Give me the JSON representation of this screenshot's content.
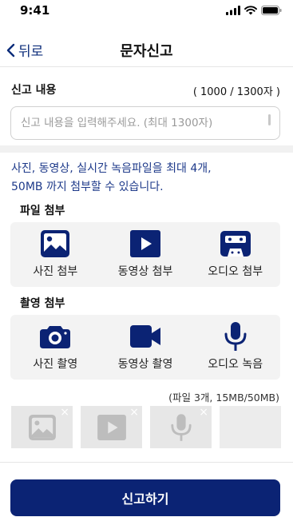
{
  "status": {
    "time": "9:41"
  },
  "nav": {
    "back_label": "뒤로",
    "title": "문자신고"
  },
  "report": {
    "label": "신고 내용",
    "counter": "( 1000 / 1300자 )",
    "placeholder": "신고 내용을 입력해주세요. (최대 1300자)"
  },
  "info": {
    "line1": "사진, 동영상, 실시간 녹음파일을 최대 4개,",
    "line2": "50MB 까지 첨부할 수 있습니다."
  },
  "file_attach": {
    "label": "파일 첨부",
    "options": [
      {
        "label": "사진 첨부",
        "icon": "image-icon"
      },
      {
        "label": "동영상 첨부",
        "icon": "video-play-icon"
      },
      {
        "label": "오디오 첨부",
        "icon": "cassette-icon"
      }
    ]
  },
  "capture": {
    "label": "촬영 첨부",
    "options": [
      {
        "label": "사진 촬영",
        "icon": "camera-icon"
      },
      {
        "label": "동영상 촬영",
        "icon": "video-camera-icon"
      },
      {
        "label": "오디오 녹음",
        "icon": "microphone-icon"
      }
    ]
  },
  "attachments": {
    "summary": "(파일 3개, 15MB/50MB)",
    "items": [
      {
        "type": "image",
        "remove": "×"
      },
      {
        "type": "video",
        "remove": "×"
      },
      {
        "type": "audio",
        "remove": "×"
      },
      {
        "type": "empty"
      }
    ]
  },
  "submit": {
    "label": "신고하기"
  },
  "colors": {
    "primary": "#0b2374",
    "accent_text": "#1e3a8a",
    "panel_bg": "#f3f3f3"
  }
}
